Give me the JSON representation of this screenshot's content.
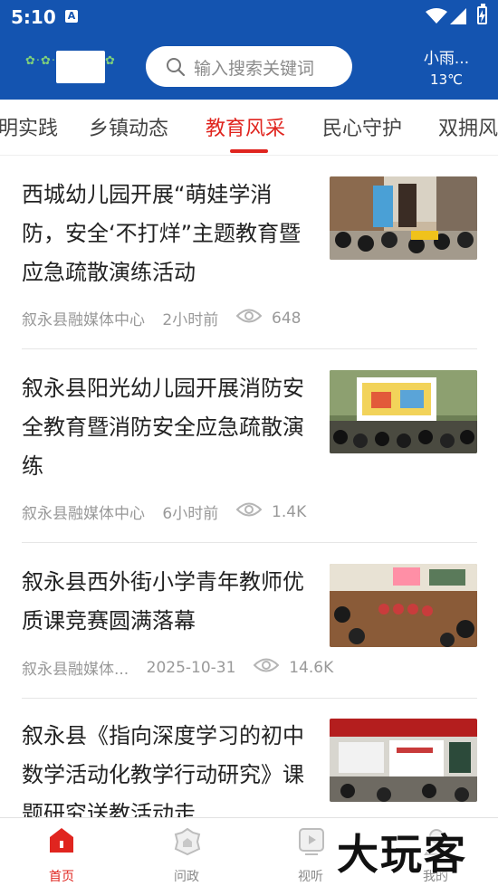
{
  "status_bar": {
    "time": "5:10",
    "sim_icon": "A"
  },
  "header": {
    "search_placeholder": "输入搜索关键词",
    "weather": {
      "condition": "小雨...",
      "temperature": "13℃"
    }
  },
  "tabs": [
    {
      "label": "明实践"
    },
    {
      "label": "乡镇动态"
    },
    {
      "label": "教育风采",
      "active": true
    },
    {
      "label": "民心守护"
    },
    {
      "label": "双拥风"
    }
  ],
  "articles": [
    {
      "title": "西城幼儿园开展“萌娃学消防，安全‘不打烊”主题教育暨应急疏散演练活动",
      "source": "叙永县融媒体中心",
      "time": "2小时前",
      "views": "648"
    },
    {
      "title": "叙永县阳光幼儿园开展消防安全教育暨消防安全应急疏散演练",
      "source": "叙永县融媒体中心",
      "time": "6小时前",
      "views": "1.4K"
    },
    {
      "title": "叙永县西外街小学青年教师优质课竞赛圆满落幕",
      "source": "叙永县融媒体...",
      "time": "2025-10-31",
      "views": "14.6K"
    },
    {
      "title": "叙永县《指向深度学习的初中数学活动化教学行动研究》课题研究送教活动走",
      "source": "",
      "time": "",
      "views": ""
    }
  ],
  "bottom_nav": [
    {
      "label": "首页",
      "icon": "home-icon",
      "active": true
    },
    {
      "label": "问政",
      "icon": "ask-icon"
    },
    {
      "label": "视听",
      "icon": "video-icon"
    },
    {
      "label": "我的",
      "icon": "profile-icon"
    }
  ],
  "watermark": "大玩客",
  "colors": {
    "header_blue": "#1454b0",
    "accent_red": "#e0251f"
  }
}
